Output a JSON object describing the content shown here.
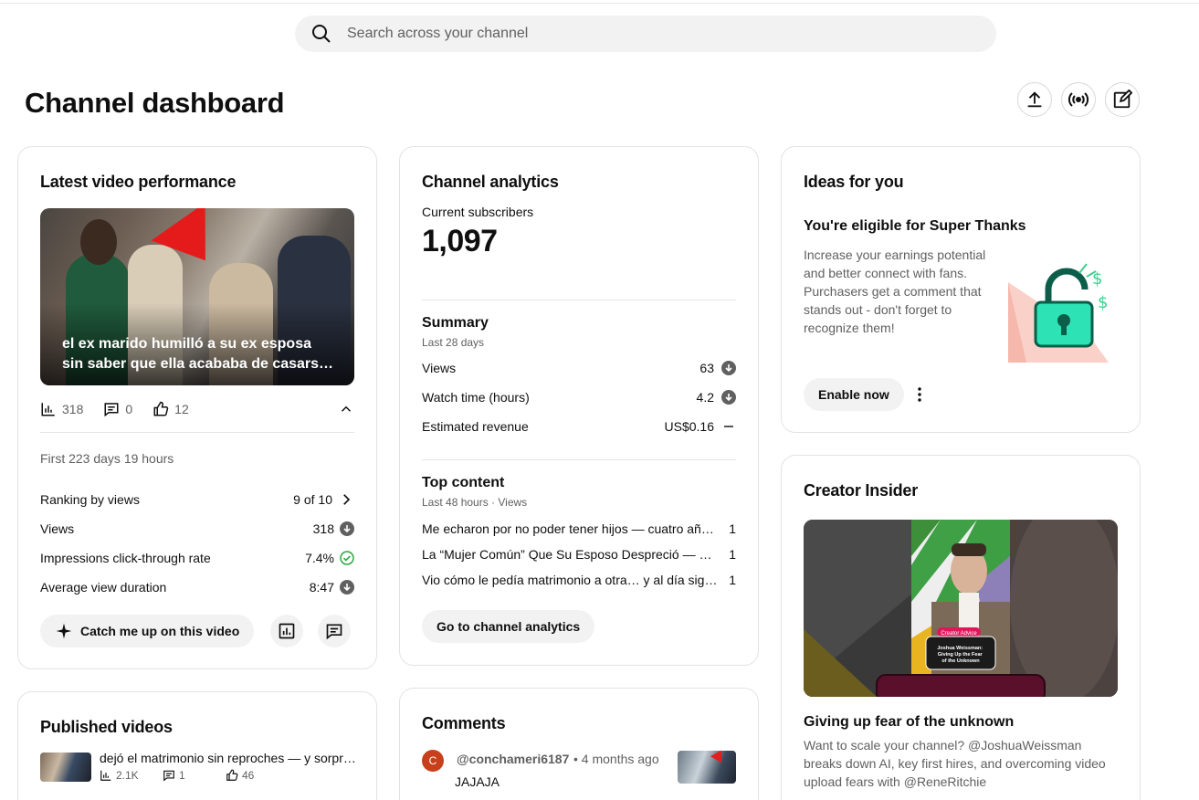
{
  "search": {
    "placeholder": "Search across your channel"
  },
  "page": {
    "title": "Channel dashboard"
  },
  "latest": {
    "heading": "Latest video performance",
    "video_title": "el ex marido humilló a su ex esposa sin saber que ella acababa de casarse con un millonario",
    "views": "318",
    "comments": "0",
    "likes": "12",
    "period": "First 223 days 19 hours",
    "rows": [
      {
        "label": "Ranking by views",
        "value": "9 of 10",
        "indicator": "chevron-right-icon"
      },
      {
        "label": "Views",
        "value": "318",
        "indicator": "arrow-down-icon"
      },
      {
        "label": "Impressions click-through rate",
        "value": "7.4%",
        "indicator": "check-circle-icon"
      },
      {
        "label": "Average view duration",
        "value": "8:47",
        "indicator": "arrow-down-icon"
      }
    ],
    "catch_up_label": "Catch me up on this video"
  },
  "analytics": {
    "heading": "Channel analytics",
    "subs_label": "Current subscribers",
    "subs_value": "1,097",
    "summary_title": "Summary",
    "summary_period": "Last 28 days",
    "summary_rows": [
      {
        "label": "Views",
        "value": "63",
        "indicator": "arrow-down-icon"
      },
      {
        "label": "Watch time (hours)",
        "value": "4.2",
        "indicator": "arrow-down-icon"
      },
      {
        "label": "Estimated revenue",
        "value": "US$0.16",
        "indicator": "dash-icon"
      }
    ],
    "top_title": "Top content",
    "top_period": "Last 48 hours · Views",
    "top_rows": [
      {
        "title": "Me echaron por no poder tener hijos — cuatro años después volví",
        "value": "1"
      },
      {
        "title": "La “Mujer Común” Que Su Esposo Despreció — Un Millonario",
        "value": "1"
      },
      {
        "title": "Vio cómo le pedía matrimonio a otra… y al día siguiente",
        "value": "1"
      }
    ],
    "go_label": "Go to channel analytics"
  },
  "comments": {
    "heading": "Comments",
    "avatar_letter": "C",
    "author": "@conchameri6187",
    "time": "• 4 months ago",
    "text": "JAJAJA"
  },
  "published": {
    "heading": "Published videos",
    "item_title": "dejó el matrimonio sin reproches — y sorprendió a todos",
    "views": "2.1K",
    "comments": "1",
    "likes": "46"
  },
  "ideas": {
    "heading": "Ideas for you",
    "title": "You're eligible for Super Thanks",
    "body": "Increase your earnings potential and better connect with fans. Purchasers get a comment that stands out - don't forget to recognize them!",
    "button": "Enable now"
  },
  "insider": {
    "heading": "Creator Insider",
    "thumb_badge": "Creator Advice",
    "thumb_caption": "Joshua Weissman: Giving Up the Fear of the Unknown",
    "title": "Giving up fear of the unknown",
    "body": "Want to scale your channel? @JoshuaWeissman breaks down AI, key first hires, and overcoming video upload fears with @ReneRitchie"
  },
  "colors": {
    "accent_green": "#2ba640",
    "avatar_orange": "#c7401b",
    "chip_bg": "#f2f2f2"
  }
}
